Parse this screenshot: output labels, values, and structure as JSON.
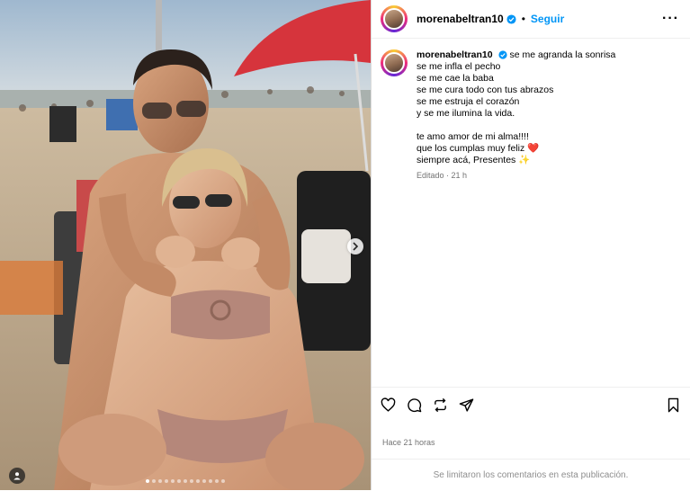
{
  "post": {
    "username": "morenabeltran10",
    "follow_label": "Seguir",
    "separator": "•",
    "more_label": "···",
    "caption_lines": [
      "se me agranda la sonrisa",
      "se me infla el pecho",
      "se me cae la baba",
      "se me cura todo con tus abrazos",
      "se me estruja el corazón",
      "y se me ilumina la vida.",
      "",
      "te amo amor de mi alma!!!!",
      "que los cumplas muy feliz ❤️",
      "siempre acá, Presentes ✨"
    ],
    "edited_label": "Editado · 21 h",
    "time_ago": "Hace 21 horas",
    "comments_disabled": "Se limitaron los comentarios en esta publicación.",
    "carousel": {
      "total_slides": 13,
      "active_slide": 1
    }
  },
  "icons": {
    "verified": "verified-badge-icon",
    "like": "heart-icon",
    "comment": "comment-icon",
    "repost": "repost-icon",
    "share": "send-icon",
    "save": "bookmark-icon",
    "next": "chevron-right-icon",
    "tag": "user-tag-icon"
  },
  "colors": {
    "accent": "#0095f6",
    "muted": "#737373",
    "border": "#dbdbdb"
  }
}
